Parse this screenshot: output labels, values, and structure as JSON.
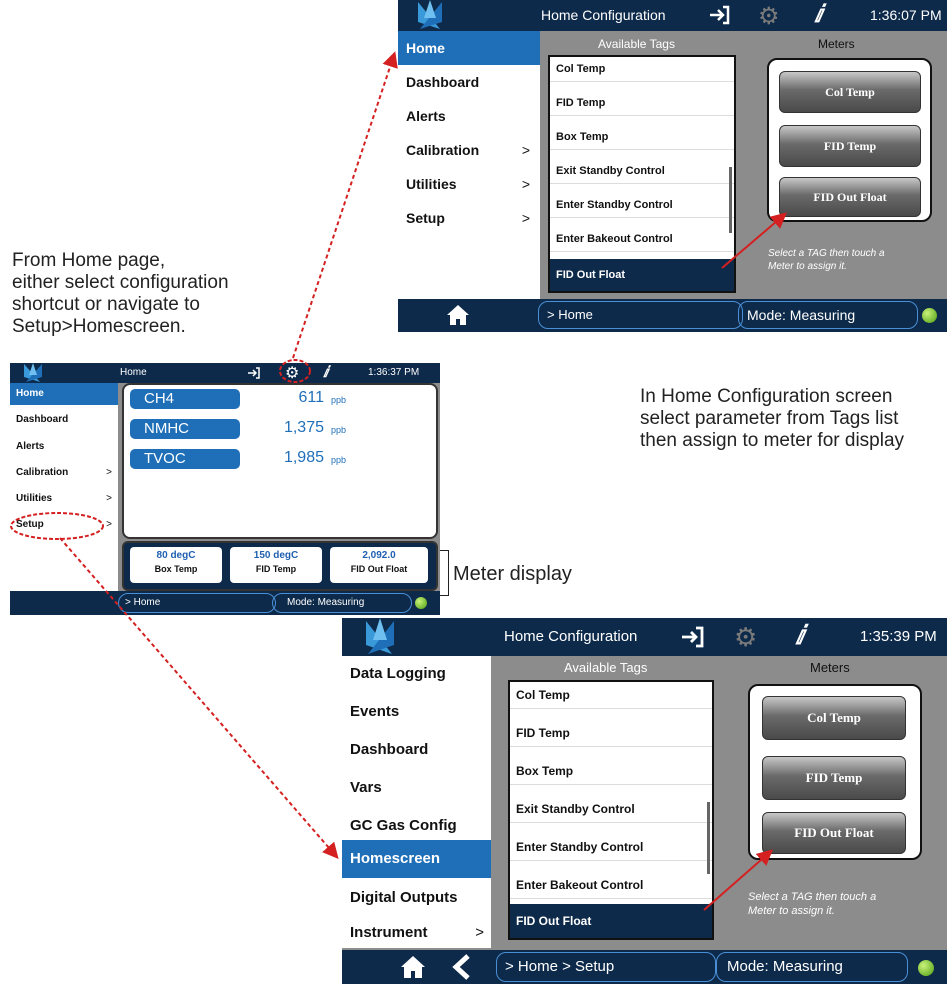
{
  "caption_left": [
    "From Home page,",
    "either select configuration",
    "shortcut or navigate to",
    "Setup>Homescreen."
  ],
  "caption_right": [
    "In Home Configuration screen",
    "select parameter from Tags list",
    "then assign to meter for display"
  ],
  "meter_display_label": "Meter display",
  "colors": {
    "topbar": "#0d2a4a",
    "accent": "#1f6fb8",
    "panel": "#8c8c8c",
    "arrow": "#d42020"
  },
  "icons": {
    "logo": "teledyne-logo-icon",
    "login": "sign-in-icon",
    "settings": "gear-icon",
    "info": "info-icon",
    "home": "home-icon",
    "back": "back-chevron-icon",
    "status": "status-led-icon"
  },
  "home_screen": {
    "title": "Home",
    "time": "1:36:37 PM",
    "sidebar": [
      {
        "label": "Home",
        "chevron": ""
      },
      {
        "label": "Dashboard",
        "chevron": ""
      },
      {
        "label": "Alerts",
        "chevron": ""
      },
      {
        "label": "Calibration",
        "chevron": ">"
      },
      {
        "label": "Utilities",
        "chevron": ">"
      },
      {
        "label": "Setup",
        "chevron": ">"
      }
    ],
    "params": [
      {
        "name": "CH4",
        "value": "611",
        "unit": "ppb"
      },
      {
        "name": "NMHC",
        "value": "1,375",
        "unit": "ppb"
      },
      {
        "name": "TVOC",
        "value": "1,985",
        "unit": "ppb"
      }
    ],
    "meters": [
      {
        "value": "80 degC",
        "label": "Box Temp"
      },
      {
        "value": "150 degC",
        "label": "FID Temp"
      },
      {
        "value": "2,092.0",
        "label": "FID Out Float"
      }
    ],
    "breadcrumb": "> Home",
    "mode": "Mode: Measuring"
  },
  "config_top": {
    "title": "Home Configuration",
    "time": "1:36:07 PM",
    "sidebar": [
      {
        "label": "Home",
        "chevron": ""
      },
      {
        "label": "Dashboard",
        "chevron": ""
      },
      {
        "label": "Alerts",
        "chevron": ""
      },
      {
        "label": "Calibration",
        "chevron": ">"
      },
      {
        "label": "Utilities",
        "chevron": ">"
      },
      {
        "label": "Setup",
        "chevron": ">"
      }
    ],
    "tags_header": "Available Tags",
    "meters_header": "Meters",
    "tags": [
      "Col Temp",
      "FID Temp",
      "Box Temp",
      "Exit Standby Control",
      "Enter Standby Control",
      "Enter Bakeout Control",
      "FID Out Float"
    ],
    "meters": [
      "Col Temp",
      "FID Temp",
      "FID Out Float"
    ],
    "hint": [
      "Select a TAG then touch a",
      "Meter to assign it."
    ],
    "breadcrumb": "> Home",
    "mode": "Mode: Measuring"
  },
  "config_bottom": {
    "title": "Home Configuration",
    "time": "1:35:39 PM",
    "sidebar": [
      {
        "label": "Data Logging",
        "chevron": ""
      },
      {
        "label": "Events",
        "chevron": ""
      },
      {
        "label": "Dashboard",
        "chevron": ""
      },
      {
        "label": "Vars",
        "chevron": ""
      },
      {
        "label": "GC Gas Config",
        "chevron": ""
      },
      {
        "label": "Homescreen",
        "chevron": ""
      },
      {
        "label": "Digital Outputs",
        "chevron": ""
      },
      {
        "label": "Instrument",
        "chevron": ">"
      }
    ],
    "tags_header": "Available Tags",
    "meters_header": "Meters",
    "tags": [
      "Col Temp",
      "FID Temp",
      "Box Temp",
      "Exit Standby Control",
      "Enter Standby Control",
      "Enter Bakeout Control",
      "FID Out Float"
    ],
    "meters": [
      "Col Temp",
      "FID Temp",
      "FID Out Float"
    ],
    "hint": [
      "Select a TAG then touch a",
      "Meter to assign it."
    ],
    "breadcrumb": "> Home > Setup",
    "mode": "Mode: Measuring"
  }
}
